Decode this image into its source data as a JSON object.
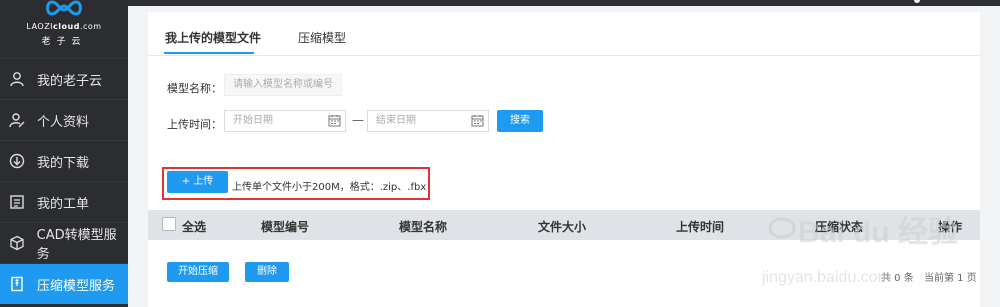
{
  "brand": {
    "logo_text_a": "LAOZI",
    "logo_text_b": "cloud",
    "logo_text_c": ".com",
    "logo_sub": "老子云"
  },
  "sidebar": {
    "items": [
      {
        "label": "我的老子云",
        "icon": "user-icon"
      },
      {
        "label": "个人资料",
        "icon": "profile-edit-icon"
      },
      {
        "label": "我的下载",
        "icon": "download-icon"
      },
      {
        "label": "我的工单",
        "icon": "ticket-icon"
      },
      {
        "label": "CAD转模型服务",
        "icon": "cube-icon"
      },
      {
        "label": "压缩模型服务",
        "icon": "compress-icon",
        "active": true
      }
    ]
  },
  "tabs": [
    {
      "label": "我上传的模型文件",
      "active": true
    },
    {
      "label": "压缩模型",
      "active": false
    }
  ],
  "filters": {
    "model_name_label": "模型名称：",
    "model_name_placeholder": "请输入模型名称或编号",
    "upload_time_label": "上传时间：",
    "start_date_placeholder": "开始日期",
    "end_date_placeholder": "结束日期",
    "separator": "—",
    "search_label": "搜索"
  },
  "upload": {
    "button_label": "+ 上传",
    "note": "上传单个文件小于200M，格式：.zip、.fbx"
  },
  "table": {
    "select_all": "全选",
    "columns": [
      "模型编号",
      "模型名称",
      "文件大小",
      "上传时间",
      "压缩状态",
      "操作"
    ]
  },
  "actions": {
    "start_compress": "开始压缩",
    "delete": "删除"
  },
  "pager": {
    "total": "共 0 条",
    "current": "当前第 1 页"
  },
  "watermark": {
    "text": "Bai du 经验",
    "url": "jingyan.baidu.com"
  },
  "colors": {
    "accent": "#1e9bf0",
    "sidebar_bg": "#2b2d31",
    "highlight": "#e03333"
  }
}
